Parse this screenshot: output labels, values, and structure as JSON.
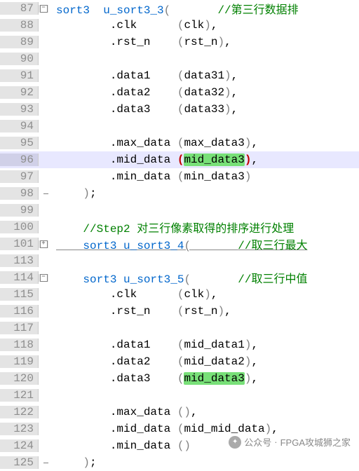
{
  "watermark": {
    "prefix": "公众号",
    "name": "FPGA攻城狮之家"
  },
  "lines": [
    {
      "num": "87",
      "fold": "minus",
      "red": "top",
      "segs": [
        [
          "sort3  u_sort3_3",
          "kw"
        ],
        [
          "(",
          "paren"
        ],
        [
          "       ",
          ""
        ],
        [
          "//第三行数据排",
          "comment"
        ]
      ]
    },
    {
      "num": "88",
      "fold": "v",
      "red": "mid",
      "segs": [
        [
          "        .clk      ",
          ""
        ],
        [
          "(",
          "paren"
        ],
        [
          "clk",
          ""
        ],
        [
          ")",
          "paren"
        ],
        [
          ",",
          ""
        ]
      ]
    },
    {
      "num": "89",
      "fold": "v",
      "red": "mid",
      "segs": [
        [
          "        .rst_n    ",
          ""
        ],
        [
          "(",
          "paren"
        ],
        [
          "rst_n",
          ""
        ],
        [
          ")",
          "paren"
        ],
        [
          ",",
          ""
        ]
      ]
    },
    {
      "num": "90",
      "fold": "v",
      "red": "mid",
      "segs": [
        [
          "",
          ""
        ]
      ]
    },
    {
      "num": "91",
      "fold": "v",
      "red": "mid",
      "segs": [
        [
          "        .data1    ",
          ""
        ],
        [
          "(",
          "paren"
        ],
        [
          "data31",
          ""
        ],
        [
          ")",
          "paren"
        ],
        [
          ",",
          ""
        ]
      ]
    },
    {
      "num": "92",
      "fold": "v",
      "red": "mid",
      "segs": [
        [
          "        .data2    ",
          ""
        ],
        [
          "(",
          "paren"
        ],
        [
          "data32",
          ""
        ],
        [
          ")",
          "paren"
        ],
        [
          ",",
          ""
        ]
      ]
    },
    {
      "num": "93",
      "fold": "v",
      "red": "mid",
      "segs": [
        [
          "        .data3    ",
          ""
        ],
        [
          "(",
          "paren"
        ],
        [
          "data33",
          ""
        ],
        [
          ")",
          "paren"
        ],
        [
          ",",
          ""
        ]
      ]
    },
    {
      "num": "94",
      "fold": "v",
      "red": "mid",
      "segs": [
        [
          "",
          ""
        ]
      ]
    },
    {
      "num": "95",
      "fold": "v",
      "red": "mid",
      "segs": [
        [
          "        .max_data ",
          ""
        ],
        [
          "(",
          "paren"
        ],
        [
          "max_data3",
          ""
        ],
        [
          ")",
          "paren"
        ],
        [
          ",",
          ""
        ]
      ]
    },
    {
      "num": "96",
      "fold": "v",
      "red": "mid",
      "current": true,
      "segs": [
        [
          "        .mid_data ",
          ""
        ],
        [
          "(",
          "paren-match"
        ],
        [
          "mid_data3",
          "hl"
        ],
        [
          ")",
          "paren-match"
        ],
        [
          ",",
          ""
        ]
      ]
    },
    {
      "num": "97",
      "fold": "v",
      "red": "mid",
      "segs": [
        [
          "        .min_data ",
          ""
        ],
        [
          "(",
          "paren"
        ],
        [
          "min_data3",
          ""
        ],
        [
          ")",
          "paren"
        ]
      ]
    },
    {
      "num": "98",
      "fold": "end",
      "red": "bot",
      "segs": [
        [
          "    ",
          ""
        ],
        [
          ")",
          "paren"
        ],
        [
          ";",
          ""
        ]
      ]
    },
    {
      "num": "99",
      "fold": "",
      "red": "",
      "segs": [
        [
          "",
          ""
        ]
      ]
    },
    {
      "num": "100",
      "fold": "",
      "red": "",
      "segs": [
        [
          "    ",
          ""
        ],
        [
          "//Step2 对三行像素取得的排序进行处理",
          "comment"
        ]
      ]
    },
    {
      "num": "101",
      "fold": "plus",
      "red": "",
      "under": true,
      "segs": [
        [
          "    ",
          ""
        ],
        [
          "sort3 u_sort3_4",
          "kw"
        ],
        [
          "(",
          "paren"
        ],
        [
          "       ",
          ""
        ],
        [
          "//取三行最大",
          "comment"
        ]
      ]
    },
    {
      "num": "113",
      "fold": "",
      "red": "",
      "segs": [
        [
          "",
          ""
        ]
      ]
    },
    {
      "num": "114",
      "fold": "minus",
      "red": "top",
      "segs": [
        [
          "    ",
          ""
        ],
        [
          "sort3 u_sort3_5",
          "kw"
        ],
        [
          "(",
          "paren"
        ],
        [
          "       ",
          ""
        ],
        [
          "//取三行中值",
          "comment"
        ]
      ]
    },
    {
      "num": "115",
      "fold": "v",
      "red": "mid",
      "segs": [
        [
          "        .clk      ",
          ""
        ],
        [
          "(",
          "paren"
        ],
        [
          "clk",
          ""
        ],
        [
          ")",
          "paren"
        ],
        [
          ",",
          ""
        ]
      ]
    },
    {
      "num": "116",
      "fold": "v",
      "red": "mid",
      "segs": [
        [
          "        .rst_n    ",
          ""
        ],
        [
          "(",
          "paren"
        ],
        [
          "rst_n",
          ""
        ],
        [
          ")",
          "paren"
        ],
        [
          ",",
          ""
        ]
      ]
    },
    {
      "num": "117",
      "fold": "v",
      "red": "mid",
      "segs": [
        [
          "",
          ""
        ]
      ]
    },
    {
      "num": "118",
      "fold": "v",
      "red": "mid",
      "segs": [
        [
          "        .data1    ",
          ""
        ],
        [
          "(",
          "paren"
        ],
        [
          "mid_data1",
          ""
        ],
        [
          ")",
          "paren"
        ],
        [
          ",",
          ""
        ]
      ]
    },
    {
      "num": "119",
      "fold": "v",
      "red": "mid",
      "segs": [
        [
          "        .data2    ",
          ""
        ],
        [
          "(",
          "paren"
        ],
        [
          "mid_data2",
          ""
        ],
        [
          ")",
          "paren"
        ],
        [
          ",",
          ""
        ]
      ]
    },
    {
      "num": "120",
      "fold": "v",
      "red": "mid",
      "segs": [
        [
          "        .data3    ",
          ""
        ],
        [
          "(",
          "paren"
        ],
        [
          "mid_data3",
          "hl"
        ],
        [
          ")",
          "paren"
        ],
        [
          ",",
          ""
        ]
      ]
    },
    {
      "num": "121",
      "fold": "v",
      "red": "mid",
      "segs": [
        [
          "",
          ""
        ]
      ]
    },
    {
      "num": "122",
      "fold": "v",
      "red": "mid",
      "segs": [
        [
          "        .max_data ",
          ""
        ],
        [
          "()",
          "paren"
        ],
        [
          ",",
          ""
        ]
      ]
    },
    {
      "num": "123",
      "fold": "v",
      "red": "mid",
      "segs": [
        [
          "        .mid_data ",
          ""
        ],
        [
          "(",
          "paren"
        ],
        [
          "mid_mid_data",
          ""
        ],
        [
          ")",
          "paren"
        ],
        [
          ",",
          ""
        ]
      ]
    },
    {
      "num": "124",
      "fold": "v",
      "red": "mid",
      "segs": [
        [
          "        .min_data ",
          ""
        ],
        [
          "()",
          "paren"
        ]
      ]
    },
    {
      "num": "125",
      "fold": "end",
      "red": "bot",
      "segs": [
        [
          "    ",
          ""
        ],
        [
          ")",
          "paren"
        ],
        [
          ";",
          ""
        ]
      ]
    }
  ]
}
